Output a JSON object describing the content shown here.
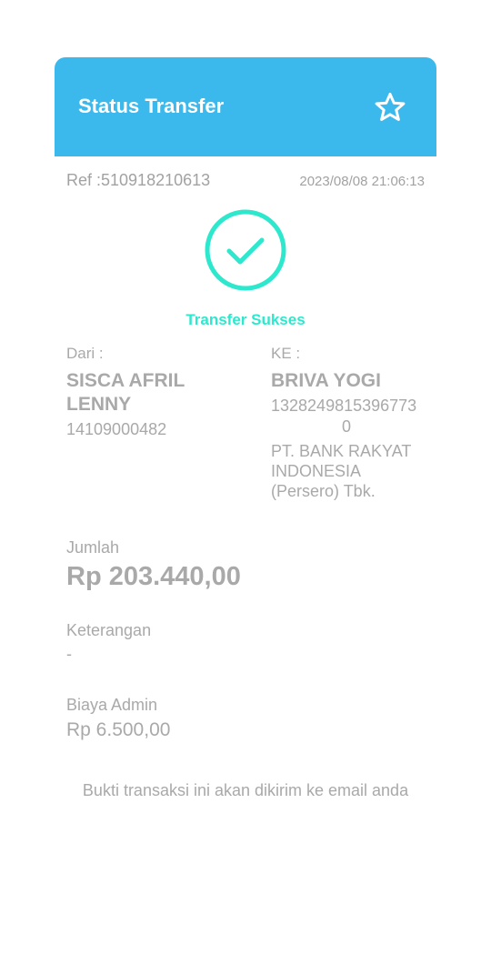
{
  "header": {
    "title": "Status Transfer",
    "star_icon": "star-outline-icon"
  },
  "transaction": {
    "ref": "Ref :510918210613",
    "datetime": "2023/08/08 21:06:13",
    "status_icon": "check-circle-icon",
    "status": "Transfer Sukses"
  },
  "sender": {
    "label": "Dari :",
    "name": "SISCA AFRIL LENNY",
    "account": "14109000482"
  },
  "recipient": {
    "label": "KE :",
    "name": "BRIVA YOGI",
    "account_line1": "1328249815396773",
    "account_line2": "0",
    "bank": "PT. BANK RAKYAT INDONESIA (Persero) Tbk."
  },
  "amount": {
    "label": "Jumlah",
    "value": "Rp 203.440,00"
  },
  "description": {
    "label": "Keterangan",
    "value": "-"
  },
  "admin_fee": {
    "label": "Biaya Admin",
    "value": "Rp 6.500,00"
  },
  "footer": {
    "note": "Bukti transaksi ini akan dikirim ke email anda"
  },
  "colors": {
    "header_bg": "#3bb8ec",
    "success": "#2de8cc",
    "muted_text": "#a9a9a9"
  }
}
